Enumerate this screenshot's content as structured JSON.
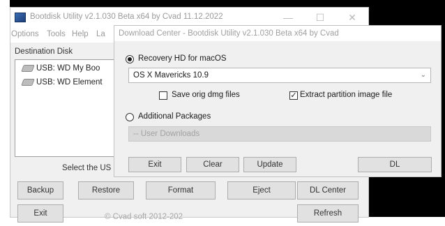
{
  "window": {
    "title": "Bootdisk Utility v2.1.030 Beta x64 by Cvad 11.12.2022",
    "controls": {
      "minimize": "—",
      "maximize": "☐",
      "close": "✕"
    }
  },
  "menu": {
    "options": "Options",
    "tools": "Tools",
    "help": "Help",
    "truncated": "La"
  },
  "destination": {
    "label": "Destination Disk",
    "disks": [
      {
        "label": "USB: WD My Boo"
      },
      {
        "label": "USB: WD Element"
      }
    ],
    "select_label": "Select the US"
  },
  "buttons": {
    "backup": "Backup",
    "restore": "Restore",
    "format": "Format",
    "eject": "Eject",
    "dl_center": "DL Center",
    "exit": "Exit",
    "refresh": "Refresh"
  },
  "copyright": "© Cvad soft 2012-202",
  "dialog": {
    "title": "Download Center - Bootdisk Utility v2.1.030 Beta x64 by Cvad",
    "recovery_option": "Recovery HD for macOS",
    "recovery_selected": true,
    "os_select": "OS X Mavericks 10.9",
    "save_dmg_label": "Save orig dmg files",
    "save_dmg_checked": false,
    "extract_label": "Extract partition image file",
    "extract_checked": true,
    "additional_option": "Additional Packages",
    "additional_selected": false,
    "packages_select": "-- User Downloads",
    "buttons": {
      "exit": "Exit",
      "clear": "Clear",
      "update": "Update",
      "dl": "DL"
    }
  }
}
